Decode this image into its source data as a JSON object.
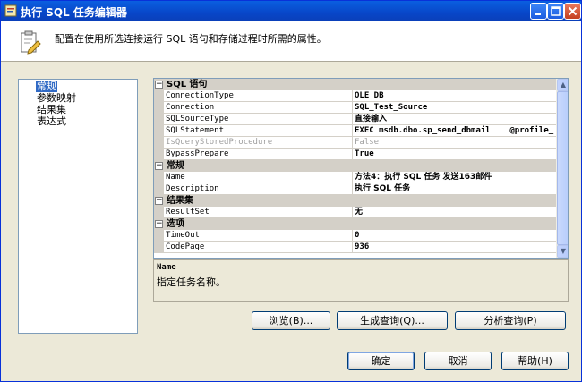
{
  "window": {
    "title": "执行 SQL 任务编辑器"
  },
  "header": {
    "description": "配置在使用所选连接运行 SQL 语句和存储过程时所需的属性。"
  },
  "nav": {
    "items": [
      {
        "label": "常规",
        "selected": true
      },
      {
        "label": "参数映射",
        "selected": false
      },
      {
        "label": "结果集",
        "selected": false
      },
      {
        "label": "表达式",
        "selected": false
      }
    ]
  },
  "grid": {
    "categories": {
      "sql": "SQL 语句",
      "general": "常规",
      "resultset": "结果集",
      "options": "选项"
    },
    "rows": {
      "connection_type": {
        "name": "ConnectionType",
        "value": "OLE DB"
      },
      "connection": {
        "name": "Connection",
        "value": "SQL_Test_Source"
      },
      "sql_source_type": {
        "name": "SQLSourceType",
        "value": "直接输入"
      },
      "sql_statement": {
        "name": "SQLStatement",
        "value": "EXEC msdb.dbo.sp_send_dbmail    @profile_"
      },
      "is_query_stored_procedure": {
        "name": "IsQueryStoredProcedure",
        "value": "False"
      },
      "bypass_prepare": {
        "name": "BypassPrepare",
        "value": "True"
      },
      "name": {
        "name": "Name",
        "value": "方法4：执行 SQL 任务 发送163邮件"
      },
      "description": {
        "name": "Description",
        "value": "执行 SQL 任务"
      },
      "result_set": {
        "name": "ResultSet",
        "value": "无"
      },
      "timeout": {
        "name": "TimeOut",
        "value": "0"
      },
      "code_page": {
        "name": "CodePage",
        "value": "936"
      }
    }
  },
  "description_panel": {
    "title": "Name",
    "text": "指定任务名称。"
  },
  "buttons": {
    "browse": "浏览(B)...",
    "build_query": "生成查询(Q)...",
    "parse_query": "分析查询(P)",
    "ok": "确定",
    "cancel": "取消",
    "help": "帮助(H)"
  },
  "icons": {
    "window_icon": "task-icon",
    "header_icon": "clipboard-edit-icon"
  },
  "colors": {
    "titlebar": "#0846c8",
    "selection": "#316ac5",
    "dialog_bg": "#ece9d8"
  }
}
